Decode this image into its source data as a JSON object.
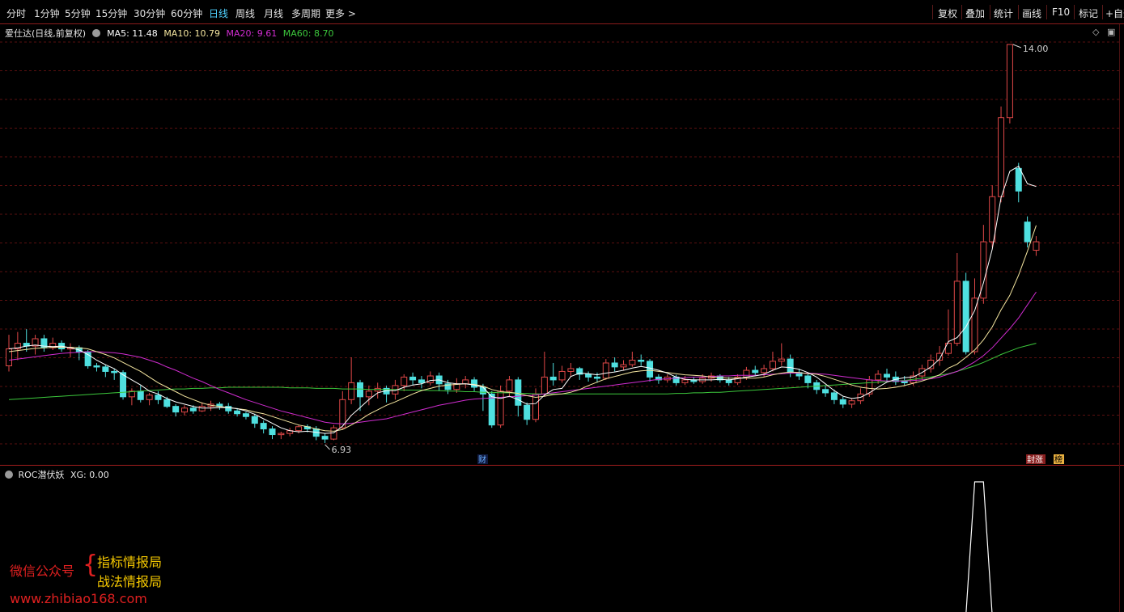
{
  "periods": [
    "分时",
    "1分钟",
    "5分钟",
    "15分钟",
    "30分钟",
    "60分钟",
    "日线",
    "周线",
    "月线",
    "多周期",
    "更多 >"
  ],
  "active_period": "日线",
  "toolbar": [
    "复权",
    "叠加",
    "统计",
    "画线",
    "F10",
    "标记",
    "+自选"
  ],
  "legend": {
    "title": "爱仕达(日线,前复权)",
    "ma5": "MA5: 11.48",
    "ma10": "MA10: 10.79",
    "ma20": "MA20: 9.61",
    "ma60": "MA60: 8.70"
  },
  "colors": {
    "up": "#e04848",
    "down": "#4fe0e0",
    "ma5": "#ffffff",
    "ma10": "#f5e6a0",
    "ma20": "#d02cd0",
    "ma60": "#3cc83c",
    "grid": "#5a1010"
  },
  "annotations": {
    "high": "14.00",
    "low": "6.93",
    "cai": "财",
    "tingzhang": "封涨",
    "bang": "榜"
  },
  "indicator": {
    "name": "ROC潜伏妖",
    "value": "XG: 0.00"
  },
  "watermark": {
    "wechat": "微信公众号",
    "brace": "{",
    "name1": "指标情报局",
    "name2": "战法情报局",
    "url": "www.zhibiao168.com"
  },
  "chart_data": {
    "type": "candlestick",
    "title": "爱仕达(日线,前复权)",
    "y_min": 6.93,
    "y_max": 14.0,
    "candles": [
      [
        8.3,
        8.6,
        8.85,
        8.2
      ],
      [
        8.6,
        8.7,
        8.9,
        8.4
      ],
      [
        8.7,
        8.65,
        8.95,
        8.55
      ],
      [
        8.65,
        8.78,
        8.85,
        8.5
      ],
      [
        8.78,
        8.62,
        8.85,
        8.55
      ],
      [
        8.62,
        8.7,
        8.8,
        8.58
      ],
      [
        8.7,
        8.6,
        8.75,
        8.55
      ],
      [
        8.6,
        8.62,
        8.7,
        8.45
      ],
      [
        8.62,
        8.55,
        8.66,
        8.4
      ],
      [
        8.55,
        8.3,
        8.58,
        8.25
      ],
      [
        8.3,
        8.28,
        8.35,
        8.2
      ],
      [
        8.28,
        8.2,
        8.32,
        8.1
      ],
      [
        8.2,
        8.18,
        8.25,
        8.05
      ],
      [
        8.18,
        7.75,
        8.22,
        7.7
      ],
      [
        7.75,
        7.85,
        7.9,
        7.6
      ],
      [
        7.85,
        7.7,
        7.95,
        7.65
      ],
      [
        7.7,
        7.78,
        7.82,
        7.6
      ],
      [
        7.78,
        7.7,
        7.85,
        7.62
      ],
      [
        7.7,
        7.58,
        7.75,
        7.55
      ],
      [
        7.58,
        7.48,
        7.62,
        7.4
      ],
      [
        7.48,
        7.55,
        7.6,
        7.42
      ],
      [
        7.55,
        7.5,
        7.6,
        7.45
      ],
      [
        7.5,
        7.58,
        7.65,
        7.48
      ],
      [
        7.58,
        7.62,
        7.68,
        7.5
      ],
      [
        7.62,
        7.58,
        7.66,
        7.52
      ],
      [
        7.58,
        7.5,
        7.64,
        7.45
      ],
      [
        7.5,
        7.45,
        7.55,
        7.4
      ],
      [
        7.45,
        7.4,
        7.48,
        7.35
      ],
      [
        7.4,
        7.28,
        7.45,
        7.2
      ],
      [
        7.28,
        7.18,
        7.33,
        7.1
      ],
      [
        7.18,
        7.08,
        7.23,
        7.0
      ],
      [
        7.08,
        7.1,
        7.13,
        7.0
      ],
      [
        7.1,
        7.15,
        7.2,
        7.05
      ],
      [
        7.15,
        7.22,
        7.25,
        7.1
      ],
      [
        7.22,
        7.18,
        7.26,
        7.12
      ],
      [
        7.18,
        7.05,
        7.23,
        6.98
      ],
      [
        7.05,
        7.0,
        7.1,
        6.93
      ],
      [
        7.0,
        7.2,
        7.25,
        6.98
      ],
      [
        7.2,
        7.7,
        7.85,
        7.18
      ],
      [
        7.7,
        8.0,
        8.45,
        7.62
      ],
      [
        8.0,
        7.75,
        8.05,
        7.5
      ],
      [
        7.75,
        7.85,
        7.95,
        7.6
      ],
      [
        7.85,
        7.9,
        8.0,
        7.72
      ],
      [
        7.9,
        7.8,
        7.95,
        7.65
      ],
      [
        7.8,
        7.95,
        8.05,
        7.7
      ],
      [
        7.95,
        8.1,
        8.15,
        7.85
      ],
      [
        8.1,
        8.05,
        8.18,
        7.95
      ],
      [
        8.05,
        8.0,
        8.12,
        7.9
      ],
      [
        8.0,
        8.12,
        8.2,
        7.95
      ],
      [
        8.12,
        7.98,
        8.18,
        7.85
      ],
      [
        7.98,
        7.88,
        8.05,
        7.8
      ],
      [
        7.88,
        7.98,
        8.08,
        7.82
      ],
      [
        7.98,
        8.05,
        8.12,
        7.9
      ],
      [
        8.05,
        7.92,
        8.1,
        7.85
      ],
      [
        7.92,
        7.8,
        7.98,
        7.5
      ],
      [
        7.8,
        7.25,
        7.85,
        7.2
      ],
      [
        7.25,
        7.85,
        7.95,
        7.2
      ],
      [
        7.85,
        8.05,
        8.12,
        7.75
      ],
      [
        8.05,
        7.6,
        8.1,
        7.4
      ],
      [
        7.6,
        7.35,
        7.65,
        7.25
      ],
      [
        7.35,
        7.8,
        7.9,
        7.3
      ],
      [
        7.8,
        8.1,
        8.55,
        7.75
      ],
      [
        8.1,
        8.05,
        8.35,
        7.95
      ],
      [
        8.05,
        8.2,
        8.3,
        8.0
      ],
      [
        8.2,
        8.25,
        8.35,
        8.1
      ],
      [
        8.25,
        8.15,
        8.28,
        8.05
      ],
      [
        8.15,
        8.1,
        8.2,
        8.02
      ],
      [
        8.1,
        8.08,
        8.18,
        8.0
      ],
      [
        8.08,
        8.35,
        8.42,
        8.05
      ],
      [
        8.35,
        8.28,
        8.45,
        8.2
      ],
      [
        8.28,
        8.32,
        8.4,
        8.22
      ],
      [
        8.32,
        8.4,
        8.55,
        8.28
      ],
      [
        8.4,
        8.38,
        8.5,
        8.3
      ],
      [
        8.38,
        8.1,
        8.42,
        8.02
      ],
      [
        8.1,
        8.05,
        8.15,
        7.98
      ],
      [
        8.05,
        8.1,
        8.15,
        8.0
      ],
      [
        8.1,
        8.0,
        8.14,
        7.95
      ],
      [
        8.0,
        8.05,
        8.12,
        7.96
      ],
      [
        8.05,
        8.02,
        8.1,
        7.98
      ],
      [
        8.02,
        8.08,
        8.15,
        7.98
      ],
      [
        8.08,
        8.12,
        8.18,
        8.02
      ],
      [
        8.12,
        8.05,
        8.15,
        8.0
      ],
      [
        8.05,
        8.0,
        8.1,
        7.95
      ],
      [
        8.0,
        8.1,
        8.15,
        7.96
      ],
      [
        8.1,
        8.22,
        8.28,
        8.05
      ],
      [
        8.22,
        8.18,
        8.3,
        8.12
      ],
      [
        8.18,
        8.25,
        8.32,
        8.1
      ],
      [
        8.25,
        8.38,
        8.55,
        8.2
      ],
      [
        8.38,
        8.42,
        8.7,
        8.3
      ],
      [
        8.42,
        8.18,
        8.5,
        8.1
      ],
      [
        8.18,
        8.12,
        8.25,
        8.05
      ],
      [
        8.12,
        8.0,
        8.15,
        7.9
      ],
      [
        8.0,
        7.88,
        8.05,
        7.8
      ],
      [
        7.88,
        7.82,
        7.95,
        7.75
      ],
      [
        7.82,
        7.7,
        7.88,
        7.62
      ],
      [
        7.7,
        7.62,
        7.75,
        7.55
      ],
      [
        7.62,
        7.68,
        7.72,
        7.55
      ],
      [
        7.68,
        7.8,
        7.9,
        7.62
      ],
      [
        7.8,
        8.05,
        8.12,
        7.75
      ],
      [
        8.05,
        8.15,
        8.22,
        7.98
      ],
      [
        8.15,
        8.1,
        8.25,
        8.02
      ],
      [
        8.1,
        8.02,
        8.2,
        7.96
      ],
      [
        8.02,
        8.0,
        8.12,
        7.95
      ],
      [
        8.0,
        8.12,
        8.2,
        7.95
      ],
      [
        8.12,
        8.25,
        8.32,
        8.05
      ],
      [
        8.25,
        8.4,
        8.5,
        8.18
      ],
      [
        8.4,
        8.52,
        8.65,
        8.3
      ],
      [
        8.52,
        8.7,
        9.3,
        8.48
      ],
      [
        8.7,
        9.8,
        10.3,
        8.65
      ],
      [
        9.8,
        8.55,
        9.95,
        8.5
      ],
      [
        8.55,
        9.5,
        9.85,
        8.5
      ],
      [
        9.5,
        10.5,
        10.8,
        9.4
      ],
      [
        10.5,
        11.3,
        11.5,
        10.4
      ],
      [
        11.3,
        12.7,
        12.9,
        11.2
      ],
      [
        12.7,
        14.0,
        14.0,
        12.6
      ],
      [
        11.8,
        11.4,
        11.9,
        11.2
      ],
      [
        10.85,
        10.5,
        10.95,
        10.4
      ],
      [
        10.35,
        10.5,
        10.6,
        10.25
      ]
    ],
    "ma5": [
      8.6,
      8.62,
      8.65,
      8.67,
      8.65,
      8.64,
      8.65,
      8.62,
      8.58,
      8.5,
      8.4,
      8.32,
      8.25,
      8.14,
      8.05,
      7.96,
      7.85,
      7.8,
      7.72,
      7.66,
      7.62,
      7.58,
      7.55,
      7.55,
      7.56,
      7.56,
      7.54,
      7.5,
      7.44,
      7.36,
      7.28,
      7.2,
      7.15,
      7.13,
      7.14,
      7.12,
      7.1,
      7.11,
      7.23,
      7.42,
      7.56,
      7.7,
      7.82,
      7.86,
      7.86,
      7.92,
      7.96,
      7.98,
      8.04,
      8.05,
      8.0,
      7.98,
      7.98,
      7.96,
      7.92,
      7.75,
      7.72,
      7.76,
      7.7,
      7.62,
      7.63,
      7.78,
      7.88,
      7.9,
      8.11,
      8.17,
      8.16,
      8.14,
      8.17,
      8.19,
      8.22,
      8.26,
      8.29,
      8.26,
      8.22,
      8.17,
      8.1,
      8.06,
      8.05,
      8.05,
      8.05,
      8.06,
      8.05,
      8.07,
      8.1,
      8.12,
      8.15,
      8.22,
      8.28,
      8.27,
      8.24,
      8.18,
      8.1,
      7.98,
      7.86,
      7.76,
      7.72,
      7.74,
      7.82,
      7.92,
      8.01,
      8.06,
      8.09,
      8.1,
      8.18,
      8.28,
      8.42,
      8.73,
      8.8,
      8.99,
      9.28,
      9.77,
      10.37,
      11.28,
      11.75,
      11.84,
      11.53,
      11.48
    ],
    "ma10": [
      8.55,
      8.57,
      8.59,
      8.61,
      8.62,
      8.63,
      8.63,
      8.63,
      8.62,
      8.6,
      8.55,
      8.5,
      8.44,
      8.36,
      8.28,
      8.2,
      8.1,
      8.0,
      7.92,
      7.84,
      7.76,
      7.7,
      7.64,
      7.6,
      7.58,
      7.56,
      7.54,
      7.52,
      7.48,
      7.45,
      7.4,
      7.35,
      7.3,
      7.25,
      7.22,
      7.18,
      7.15,
      7.14,
      7.17,
      7.25,
      7.34,
      7.44,
      7.52,
      7.6,
      7.66,
      7.73,
      7.8,
      7.86,
      7.9,
      7.94,
      7.96,
      7.97,
      7.98,
      7.97,
      7.94,
      7.88,
      7.84,
      7.83,
      7.81,
      7.77,
      7.74,
      7.76,
      7.79,
      7.8,
      7.83,
      7.88,
      7.95,
      8.01,
      8.07,
      8.11,
      8.15,
      8.19,
      8.21,
      8.22,
      8.2,
      8.18,
      8.16,
      8.14,
      8.13,
      8.12,
      8.1,
      8.09,
      8.08,
      8.08,
      8.08,
      8.08,
      8.1,
      8.14,
      8.17,
      8.19,
      8.18,
      8.16,
      8.15,
      8.11,
      8.06,
      8.01,
      7.96,
      7.92,
      7.9,
      7.89,
      7.9,
      7.92,
      7.95,
      7.99,
      8.03,
      8.08,
      8.14,
      8.26,
      8.33,
      8.45,
      8.58,
      8.76,
      8.99,
      9.29,
      9.55,
      9.91,
      10.33,
      10.79
    ],
    "ma20": [
      8.4,
      8.42,
      8.44,
      8.46,
      8.48,
      8.5,
      8.52,
      8.53,
      8.54,
      8.55,
      8.55,
      8.54,
      8.53,
      8.51,
      8.48,
      8.45,
      8.4,
      8.35,
      8.28,
      8.22,
      8.15,
      8.08,
      8.02,
      7.95,
      7.88,
      7.82,
      7.76,
      7.7,
      7.65,
      7.6,
      7.55,
      7.5,
      7.46,
      7.42,
      7.38,
      7.34,
      7.3,
      7.28,
      7.27,
      7.28,
      7.3,
      7.32,
      7.34,
      7.36,
      7.4,
      7.44,
      7.48,
      7.52,
      7.56,
      7.6,
      7.63,
      7.66,
      7.69,
      7.71,
      7.72,
      7.73,
      7.74,
      7.75,
      7.76,
      7.77,
      7.78,
      7.8,
      7.82,
      7.84,
      7.86,
      7.88,
      7.9,
      7.92,
      7.94,
      7.96,
      7.98,
      8.0,
      8.02,
      8.04,
      8.06,
      8.07,
      8.08,
      8.09,
      8.1,
      8.1,
      8.11,
      8.12,
      8.12,
      8.13,
      8.13,
      8.13,
      8.14,
      8.15,
      8.16,
      8.17,
      8.17,
      8.17,
      8.16,
      8.15,
      8.13,
      8.11,
      8.09,
      8.07,
      8.05,
      8.04,
      8.03,
      8.03,
      8.03,
      8.04,
      8.05,
      8.07,
      8.1,
      8.15,
      8.2,
      8.28,
      8.37,
      8.48,
      8.62,
      8.79,
      8.96,
      9.15,
      9.38,
      9.61
    ],
    "ma60": [
      7.7,
      7.71,
      7.72,
      7.73,
      7.74,
      7.75,
      7.76,
      7.77,
      7.78,
      7.79,
      7.8,
      7.81,
      7.82,
      7.83,
      7.84,
      7.85,
      7.86,
      7.87,
      7.88,
      7.89,
      7.89,
      7.9,
      7.9,
      7.91,
      7.91,
      7.92,
      7.92,
      7.92,
      7.92,
      7.92,
      7.92,
      7.92,
      7.91,
      7.91,
      7.91,
      7.9,
      7.9,
      7.9,
      7.89,
      7.89,
      7.89,
      7.88,
      7.88,
      7.88,
      7.88,
      7.87,
      7.87,
      7.87,
      7.86,
      7.86,
      7.85,
      7.85,
      7.84,
      7.84,
      7.83,
      7.83,
      7.82,
      7.82,
      7.81,
      7.81,
      7.8,
      7.8,
      7.8,
      7.8,
      7.8,
      7.8,
      7.8,
      7.8,
      7.8,
      7.8,
      7.8,
      7.8,
      7.8,
      7.8,
      7.8,
      7.8,
      7.81,
      7.81,
      7.82,
      7.82,
      7.83,
      7.83,
      7.84,
      7.85,
      7.86,
      7.87,
      7.88,
      7.89,
      7.9,
      7.91,
      7.92,
      7.93,
      7.94,
      7.95,
      7.96,
      7.97,
      7.98,
      7.99,
      8.0,
      8.01,
      8.02,
      8.03,
      8.04,
      8.06,
      8.08,
      8.1,
      8.13,
      8.16,
      8.2,
      8.25,
      8.3,
      8.36,
      8.43,
      8.5,
      8.56,
      8.62,
      8.66,
      8.7
    ],
    "signal_index": [
      110,
      111
    ]
  }
}
